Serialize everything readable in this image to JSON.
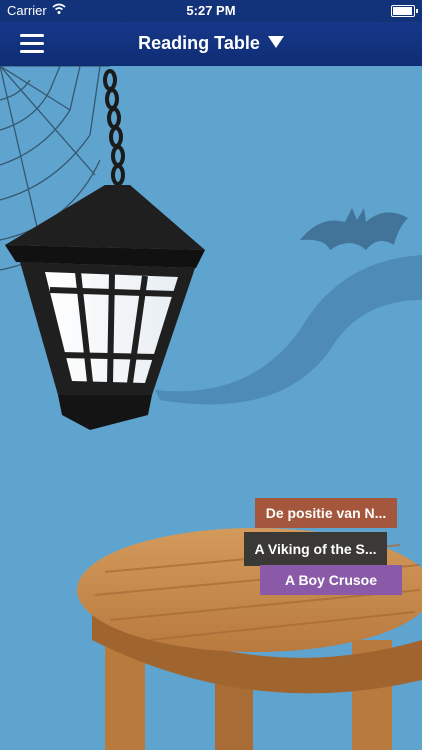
{
  "status_bar": {
    "carrier": "Carrier",
    "time": "5:27 PM"
  },
  "nav": {
    "title": "Reading Table"
  },
  "books": [
    {
      "title": "De positie van N...",
      "color": "#a4573c"
    },
    {
      "title": "A Viking of the S...",
      "color": "#3b3936"
    },
    {
      "title": "A Boy Crusoe",
      "color": "#8a5aa8"
    }
  ],
  "icons": [
    "menu-icon",
    "dropdown-triangle-icon",
    "wifi-icon",
    "battery-icon",
    "lantern-icon",
    "bat-icon",
    "spider-web-icon"
  ]
}
